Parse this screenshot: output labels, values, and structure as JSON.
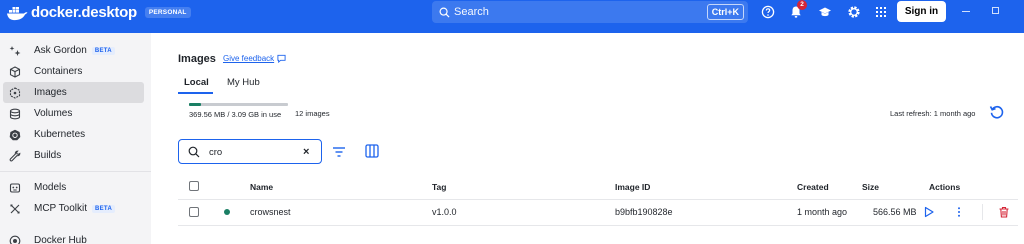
{
  "app": {
    "brand": "docker.desktop",
    "plan_badge": "PERSONAL",
    "search_placeholder": "Search",
    "search_shortcut": "Ctrl+K",
    "notification_count": "2",
    "signin_label": "Sign in",
    "accent_color": "#1d63ed"
  },
  "sidebar": {
    "items": [
      {
        "label": "Ask Gordon",
        "badge": "BETA",
        "icon": "sparkle-icon"
      },
      {
        "label": "Containers",
        "icon": "containers-icon"
      },
      {
        "label": "Images",
        "icon": "images-icon",
        "active": true
      },
      {
        "label": "Volumes",
        "icon": "volumes-icon"
      },
      {
        "label": "Kubernetes",
        "icon": "kubernetes-icon"
      },
      {
        "label": "Builds",
        "icon": "builds-icon"
      },
      {
        "label": "Models",
        "icon": "models-icon"
      },
      {
        "label": "MCP Toolkit",
        "badge": "BETA",
        "icon": "mcp-icon"
      },
      {
        "label": "Docker Hub",
        "icon": "docker-hub-icon"
      }
    ]
  },
  "main": {
    "title": "Images",
    "feedback_link": "Give feedback",
    "tabs": [
      {
        "label": "Local",
        "active": true
      },
      {
        "label": "My Hub"
      }
    ],
    "usage_text": "369.56 MB / 3.09 GB in use",
    "usage_fraction": 0.12,
    "image_count": "12 images",
    "last_refresh": "Last refresh: 1 month ago",
    "filter_value": "cro",
    "table": {
      "columns": [
        "Name",
        "Tag",
        "Image ID",
        "Created",
        "Size",
        "Actions"
      ],
      "rows": [
        {
          "name": "crowsnest",
          "tag": "v1.0.0",
          "image_id": "b9bfb190828e",
          "created": "1 month ago",
          "size": "566.56 MB",
          "status": "in-use"
        }
      ]
    }
  }
}
